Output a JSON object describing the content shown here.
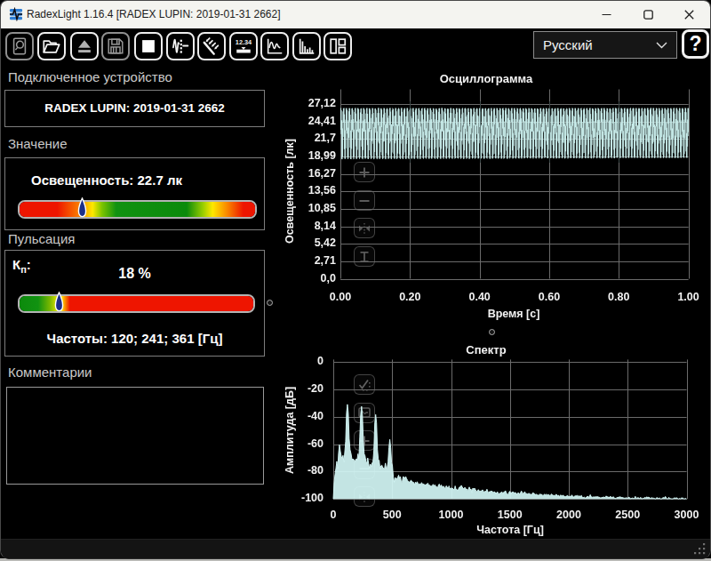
{
  "window": {
    "title": "RadexLight 1.16.4 [RADEX LUPIN: 2019-01-31 2662]"
  },
  "toolbar": {
    "buttons": [
      {
        "icon": "preview-zoom-icon",
        "enabled": false
      },
      {
        "icon": "open-folder-icon",
        "enabled": true
      },
      {
        "icon": "eject-icon",
        "enabled": false
      },
      {
        "icon": "save-icon",
        "enabled": false
      },
      {
        "icon": "stop-icon",
        "enabled": true
      },
      {
        "icon": "pulsation-icon",
        "enabled": true
      },
      {
        "icon": "light-rays-icon",
        "enabled": true
      },
      {
        "icon": "numeric-display-icon",
        "enabled": true
      },
      {
        "icon": "oscillogram-icon",
        "enabled": true
      },
      {
        "icon": "spectrum-icon",
        "enabled": true
      },
      {
        "icon": "layout-icon",
        "enabled": true
      }
    ],
    "language": {
      "value": "Русский"
    },
    "display_icon_text": "12.34",
    "help_label": "?"
  },
  "device": {
    "label": "Подключенное устройство",
    "name": "RADEX LUPIN: 2019-01-31 2662"
  },
  "value_section": {
    "label": "Значение",
    "reading": "Освещенность: 22.7 лк",
    "marker_fraction": 0.27
  },
  "pulsation": {
    "label": "Пульсация",
    "kp_k": "К",
    "kp_sub": "п",
    "kp_colon": ":",
    "kp_value": "18 %",
    "marker_fraction": 0.175,
    "frequencies": "Частоты: 120; 241; 361 [Гц]"
  },
  "comments": {
    "label": "Комментарии",
    "text": ""
  },
  "chart_data": [
    {
      "type": "line",
      "title": "Осциллограмма",
      "xlabel": "Время [с]",
      "ylabel": "Освещенность [лк]",
      "xlim": [
        0,
        1
      ],
      "ylim": [
        0,
        28.9
      ],
      "grid": true,
      "x_ticks": [
        "0.00",
        "0.20",
        "0.40",
        "0.60",
        "0.80",
        "1.00"
      ],
      "x_tick_values": [
        0,
        0.2,
        0.4,
        0.6,
        0.8,
        1.0
      ],
      "y_ticks": [
        "27,12",
        "24,41",
        "21,7",
        "18,99",
        "16,27",
        "13,56",
        "10,85",
        "8,14",
        "5,42",
        "2,71",
        "0,0"
      ],
      "y_tick_values": [
        27.12,
        24.41,
        21.7,
        18.99,
        16.27,
        13.56,
        10.85,
        8.14,
        5.42,
        2.71,
        0.0
      ],
      "signal": {
        "mean": 23.05,
        "components": [
          {
            "freq": 120.3,
            "amp": 3.62,
            "phase": 0.0
          },
          {
            "freq": 240.7,
            "amp": 0.52,
            "phase": 2.0
          },
          {
            "freq": 361.0,
            "amp": 0.33,
            "phase": 4.1
          }
        ],
        "noise_amp": 0.14,
        "samples": 1100,
        "seed": 7
      }
    },
    {
      "type": "area",
      "title": "Спектр",
      "xlabel": "Частота [Гц]",
      "ylabel": "Амплитуда [дБ]",
      "xlim": [
        0,
        3000
      ],
      "ylim": [
        -100,
        0
      ],
      "grid": true,
      "x_ticks": [
        "0",
        "500",
        "1000",
        "1500",
        "2000",
        "2500",
        "3000"
      ],
      "x_tick_values": [
        0,
        500,
        1000,
        1500,
        2000,
        2500,
        3000
      ],
      "y_ticks": [
        "0",
        "-20",
        "-40",
        "-60",
        "-80",
        "-100"
      ],
      "y_tick_values": [
        0,
        -20,
        -40,
        -60,
        -80,
        -100
      ],
      "peaks": [
        {
          "freq": 120,
          "db": -30.9
        },
        {
          "freq": 241,
          "db": -32.3
        },
        {
          "freq": 361,
          "db": -38.3
        },
        {
          "freq": 481,
          "db": -52.5
        }
      ],
      "freq_step_hz": 7.5,
      "values_db": [
        -100,
        -88,
        -82.1,
        -77.6,
        -72.5,
        -77.8,
        -66.3,
        -60.4,
        -64.9,
        -68.7,
        -70.6,
        -68.2,
        -73,
        -66.1,
        -58,
        -37.1,
        -30.9,
        -37.1,
        -55.8,
        -64.1,
        -66.6,
        -70.3,
        -71.3,
        -70.9,
        -72.4,
        -72,
        -70.7,
        -71.4,
        -67,
        -70.6,
        -54.9,
        -38.5,
        -32.3,
        -38.5,
        -57.4,
        -67.1,
        -68.5,
        -72.9,
        -73.8,
        -70,
        -74.4,
        -77.7,
        -74.5,
        -76.4,
        -73.7,
        -72.7,
        -64.1,
        -44.5,
        -38.3,
        -44.5,
        -64,
        -71.2,
        -72,
        -78.2,
        -75.8,
        -75.3,
        -77.2,
        -77.5,
        -78.1,
        -73.8,
        -77.9,
        -77.1,
        -73.1,
        -62.5,
        -56.5,
        -62.4,
        -73.4,
        -75.9,
        -83.9,
        -87.7,
        -84.5,
        -84.9,
        -85.3,
        -84.2,
        -82.6,
        -84.9,
        -83.7,
        -87.9,
        -87.8,
        -83.8,
        -84,
        -85,
        -83.6,
        -85.1,
        -86.4,
        -87,
        -87.7,
        -87.4,
        -86.3,
        -86.9,
        -87.9,
        -87.9,
        -89.9,
        -87.7,
        -88.7,
        -87.4,
        -88.9,
        -89.3,
        -88.8,
        -89.7,
        -88,
        -89.1,
        -89.1,
        -89.3,
        -90,
        -89.3,
        -89.7,
        -88.4,
        -90,
        -89.8,
        -90.6,
        -90.6,
        -90.6,
        -89.3,
        -90.4,
        -89.7,
        -90.9,
        -91,
        -92.5,
        -90.1,
        -89.1,
        -91.2,
        -89.8,
        -90.4,
        -91.8,
        -90.6,
        -92.2,
        -91.7,
        -90.4,
        -91.4,
        -92.7,
        -90.5,
        -92.8,
        -92,
        -92.3,
        -92.1,
        -92.8,
        -93.6,
        -90.5,
        -93.1,
        -93.1,
        -94.5,
        -92.3,
        -91.3,
        -91.3,
        -90.1,
        -91.3,
        -92.3,
        -92.7,
        -91.5,
        -92.9,
        -92.7,
        -93.8,
        -92.9,
        -91.3,
        -93.2,
        -92.8,
        -95.4,
        -92.1,
        -93,
        -92.1,
        -93.3,
        -94.3,
        -94.8,
        -93.2,
        -93.7,
        -94.6,
        -93.9,
        -94.5,
        -93.3,
        -94.4,
        -95.2,
        -94.2,
        -94.7,
        -92.9,
        -94.7,
        -95.6,
        -94.5,
        -94.7,
        -94.3,
        -94.4,
        -95.6,
        -94.8,
        -94.9,
        -96,
        -95.5,
        -94.8,
        -96.5,
        -96.1,
        -95.6,
        -95.3,
        -94.8,
        -96.5,
        -95,
        -94.8,
        -94,
        -95.8,
        -96.3,
        -96.9,
        -95,
        -94.4,
        -96.2,
        -95.2,
        -94.9,
        -94.9,
        -96.1,
        -95.2,
        -95.8,
        -96.7,
        -95.6,
        -95.6,
        -96.8,
        -95.5,
        -94.2,
        -95.5,
        -96.1,
        -95.2,
        -94.8,
        -96.4,
        -96,
        -96.7,
        -95.9,
        -96.1,
        -96.4,
        -96.8,
        -96.4,
        -95.5,
        -95.8,
        -96.3,
        -96.8,
        -96.6,
        -97,
        -97.3,
        -97.1,
        -96.5,
        -96.7,
        -96.7,
        -97.4,
        -97.5,
        -96.5,
        -97.1,
        -96.5,
        -97.4,
        -96.7,
        -97,
        -97.4,
        -97.4,
        -96.4,
        -96.9,
        -97.4,
        -97.3,
        -98.1,
        -96.7,
        -96.8,
        -97.7,
        -97.3,
        -98.8,
        -97.2,
        -97.4,
        -97.6,
        -97.4,
        -97.6,
        -98.3,
        -98.2,
        -98,
        -97.5,
        -98,
        -98.3,
        -97.9,
        -98.6,
        -97.1,
        -98,
        -98.6,
        -98.1,
        -97.7,
        -97.9,
        -97.3,
        -98.9,
        -97.5,
        -98.3,
        -97.9,
        -97.5,
        -98.9,
        -99,
        -98.6,
        -99.2,
        -99.3,
        -98.4,
        -98,
        -98.7,
        -98.3,
        -96.9,
        -98.4,
        -98.7,
        -98.7,
        -98.4,
        -98.8,
        -98.3,
        -98.6,
        -98.3,
        -98.6,
        -98.7,
        -99.1,
        -99.3,
        -98.9,
        -98.9,
        -98.6,
        -98.8,
        -99,
        -97.8,
        -98.7,
        -98.3,
        -99.3,
        -98.4,
        -98.3,
        -98.7,
        -99.3,
        -98.3,
        -99.2,
        -99.6,
        -99.7,
        -98.9,
        -99.2,
        -98.6,
        -98.7,
        -98.4,
        -98.9,
        -99,
        -99,
        -99.4,
        -99.4,
        -99.4,
        -99,
        -99.5,
        -99.1,
        -98.6,
        -100,
        -99.5,
        -99.6,
        -99.2,
        -99.8,
        -99.5,
        -98.1,
        -99.8,
        -99.2,
        -99.1,
        -99.3,
        -99.8,
        -98.8,
        -100,
        -99.7,
        -99.4,
        -99.5,
        -98.7,
        -99.4,
        -98.4,
        -99.3,
        -98.6,
        -99.1,
        -99.4,
        -99.5,
        -98.9,
        -99.6,
        -99.4,
        -99.7,
        -100,
        -99.1,
        -99.1,
        -99.9,
        -99.2,
        -99.5,
        -100,
        -99.9,
        -99.1,
        -99,
        -99.3,
        -98.2,
        -99.3,
        -99.8,
        -100,
        -98.8,
        -99.7,
        -99.7,
        -99.9,
        -99.9,
        -99.7,
        -99.3,
        -99.3,
        -99.4,
        -99.1,
        -99.8,
        -100,
        -99.6,
        -100,
        -99.2,
        -99.3,
        -99.3,
        -100,
        -99.8,
        -99.6,
        -100
      ]
    }
  ]
}
